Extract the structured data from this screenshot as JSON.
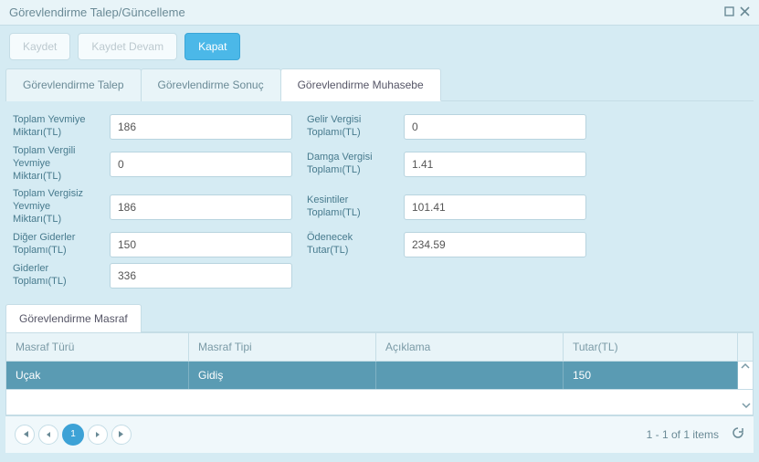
{
  "window": {
    "title": "Görevlendirme Talep/Güncelleme"
  },
  "toolbar": {
    "save": "Kaydet",
    "saveContinue": "Kaydet Devam",
    "close": "Kapat"
  },
  "tabs": {
    "t1": "Görevlendirme Talep",
    "t2": "Görevlendirme Sonuç",
    "t3": "Görevlendirme Muhasebe"
  },
  "form": {
    "toplamYevmiyeLabel": "Toplam Yevmiye Miktarı(TL)",
    "toplamYevmiye": "186",
    "gelirVergisiLabel": "Gelir Vergisi Toplamı(TL)",
    "gelirVergisi": "0",
    "toplamVergiliLabel": "Toplam Vergili Yevmiye Miktarı(TL)",
    "toplamVergili": "0",
    "damgaVergisiLabel": "Damga Vergisi Toplamı(TL)",
    "damgaVergisi": "1.41",
    "toplamVergisizLabel": "Toplam Vergisiz Yevmiye Miktarı(TL)",
    "toplamVergisiz": "186",
    "kesintilerLabel": "Kesintiler Toplamı(TL)",
    "kesintiler": "101.41",
    "digerGiderlerLabel": "Diğer Giderler Toplamı(TL)",
    "digerGiderler": "150",
    "odenecekLabel": "Ödenecek Tutar(TL)",
    "odenecek": "234.59",
    "giderlerLabel": "Giderler Toplamı(TL)",
    "giderler": "336"
  },
  "lowerTab": "Görevlendirme Masraf",
  "grid": {
    "headers": {
      "masrafTuru": "Masraf Türü",
      "masrafTipi": "Masraf Tipi",
      "aciklama": "Açıklama",
      "tutar": "Tutar(TL)"
    },
    "rows": [
      {
        "turu": "Uçak",
        "tipi": "Gidiş",
        "aciklama": "",
        "tutar": "150"
      }
    ],
    "page": "1",
    "status": "1 - 1 of 1 items"
  }
}
